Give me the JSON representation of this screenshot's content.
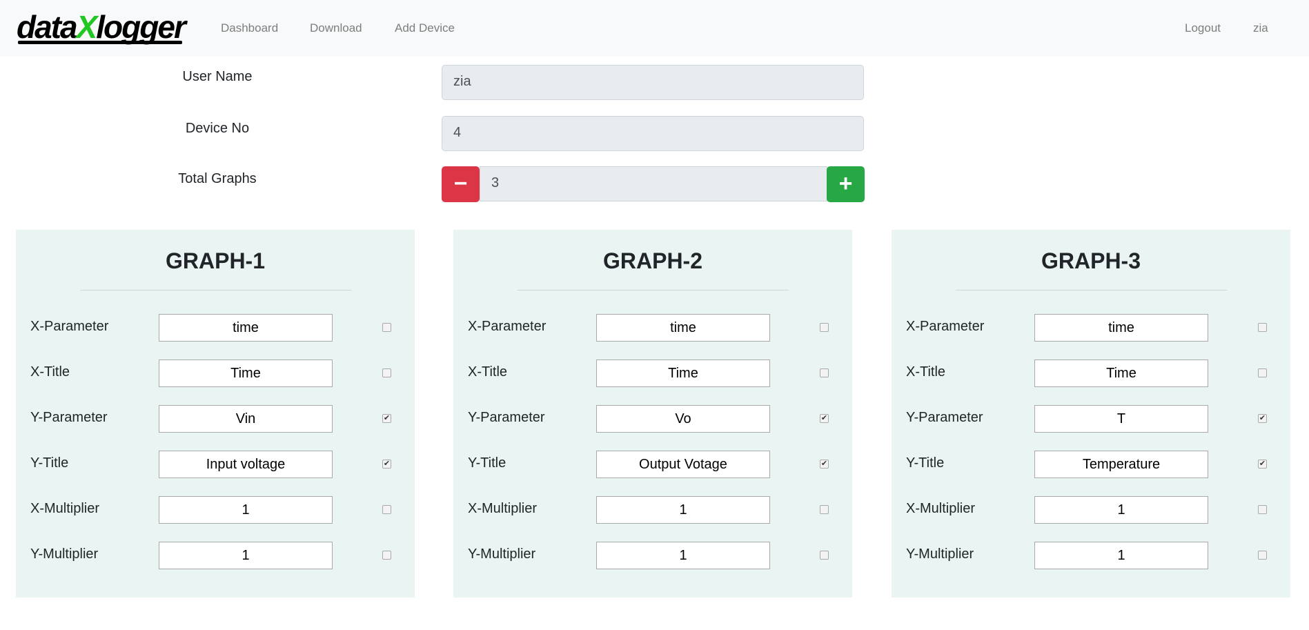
{
  "nav": {
    "logo": "dataXlogger",
    "logo_a": "data",
    "logo_x": "X",
    "logo_b": "logger",
    "links": [
      "Dashboard",
      "Download",
      "Add Device"
    ],
    "logout": "Logout",
    "user": "zia"
  },
  "form": {
    "user_name_label": "User Name",
    "user_name": "zia",
    "device_label": "Device No",
    "device": "4",
    "total_label": "Total Graphs",
    "total": "3",
    "minus": "−",
    "plus": "+"
  },
  "colors": {
    "minus": "#dc3545",
    "plus": "#28a745",
    "logo_x": "#22c722"
  },
  "graphs": [
    {
      "title": "GRAPH-1",
      "rows": [
        {
          "label": "X-Parameter",
          "value": "time",
          "checked": false
        },
        {
          "label": "X-Title",
          "value": "Time",
          "checked": false
        },
        {
          "label": "Y-Parameter",
          "value": "Vin",
          "checked": true
        },
        {
          "label": "Y-Title",
          "value": "Input voltage",
          "checked": true
        },
        {
          "label": "X-Multiplier",
          "value": "1",
          "checked": false
        },
        {
          "label": "Y-Multiplier",
          "value": "1",
          "checked": false
        }
      ]
    },
    {
      "title": "GRAPH-2",
      "rows": [
        {
          "label": "X-Parameter",
          "value": "time",
          "checked": false
        },
        {
          "label": "X-Title",
          "value": "Time",
          "checked": false
        },
        {
          "label": "Y-Parameter",
          "value": "Vo",
          "checked": true
        },
        {
          "label": "Y-Title",
          "value": "Output Votage",
          "checked": true
        },
        {
          "label": "X-Multiplier",
          "value": "1",
          "checked": false
        },
        {
          "label": "Y-Multiplier",
          "value": "1",
          "checked": false
        }
      ]
    },
    {
      "title": "GRAPH-3",
      "rows": [
        {
          "label": "X-Parameter",
          "value": "time",
          "checked": false
        },
        {
          "label": "X-Title",
          "value": "Time",
          "checked": false
        },
        {
          "label": "Y-Parameter",
          "value": "T",
          "checked": true
        },
        {
          "label": "Y-Title",
          "value": "Temperature",
          "checked": true
        },
        {
          "label": "X-Multiplier",
          "value": "1",
          "checked": false
        },
        {
          "label": "Y-Multiplier",
          "value": "1",
          "checked": false
        }
      ]
    }
  ]
}
